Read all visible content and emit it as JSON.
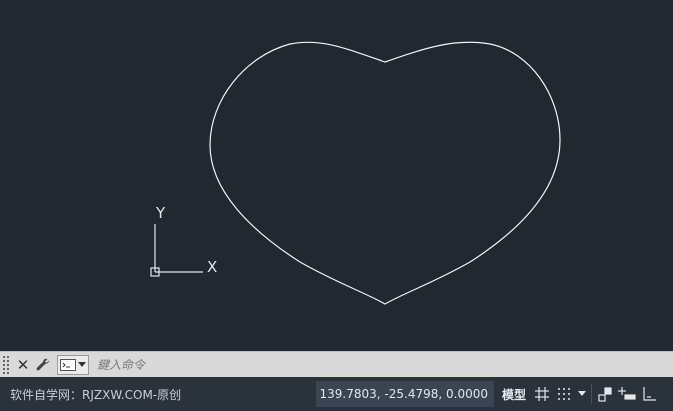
{
  "canvas": {
    "ucs": {
      "x_label": "X",
      "y_label": "Y"
    }
  },
  "command_line": {
    "placeholder": "鍵入命令"
  },
  "status_bar": {
    "watermark": "软件自学网：RJZXW.COM-原创",
    "coordinates": "139.7803, -25.4798, 0.0000",
    "model_label": "模型"
  },
  "colors": {
    "canvas_bg": "#212830",
    "curve": "#ffffff",
    "statusbar_bg": "#2a323c",
    "cmdbar_bg": "#d9d9d9"
  }
}
